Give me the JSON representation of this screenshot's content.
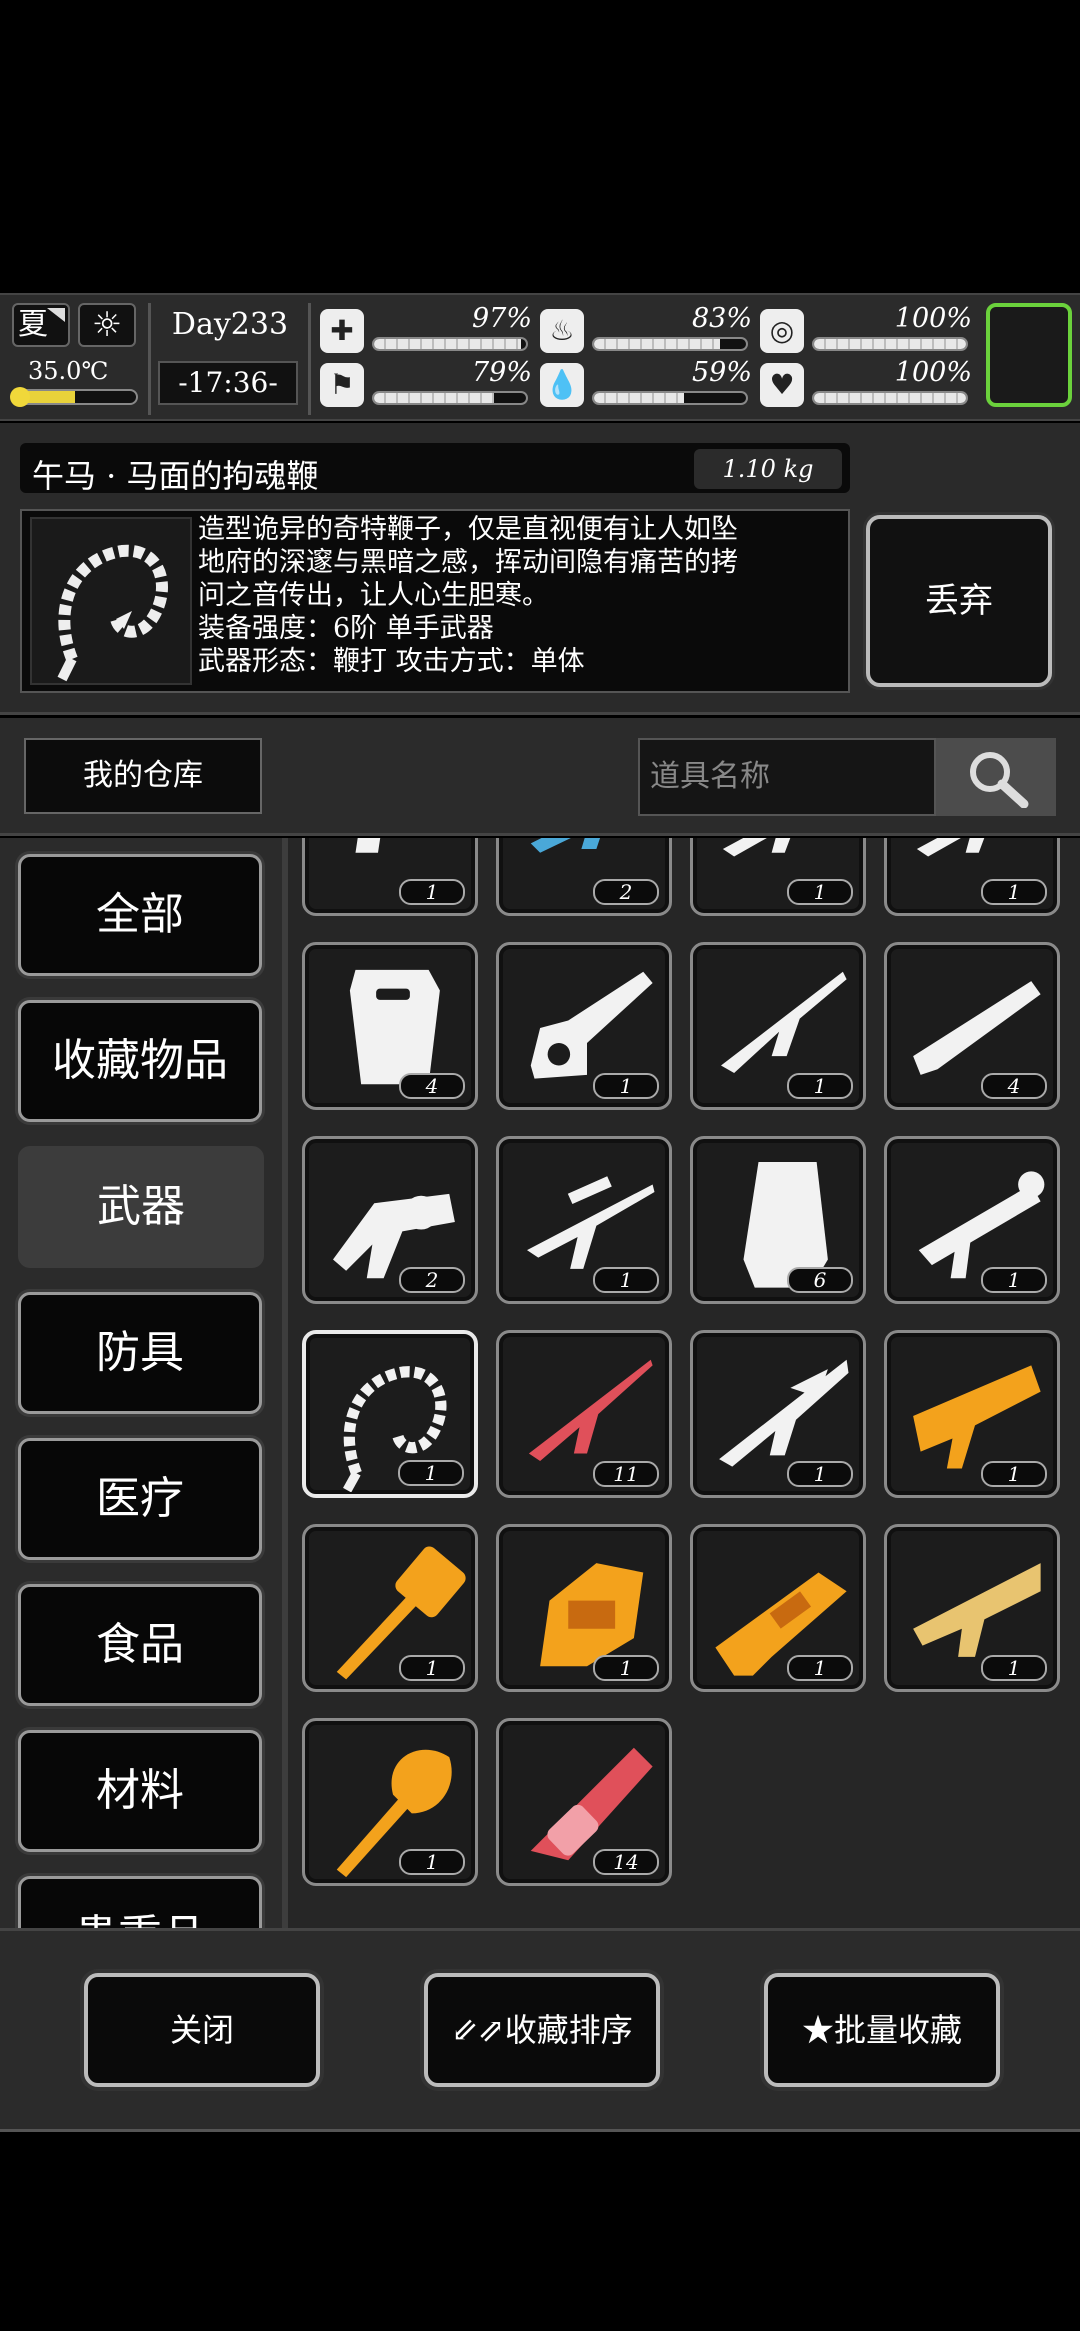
{
  "status": {
    "season": "夏",
    "weather_icon": "sun-icon",
    "temperature": "35.0℃",
    "temperature_level": 0.5,
    "day": "Day233",
    "clock": "-17:36-",
    "stats": [
      {
        "icon": "medkit-icon",
        "glyph": "✚",
        "percent": "97%",
        "level": 0.97
      },
      {
        "icon": "stomach-icon",
        "glyph": "♨",
        "percent": "83%",
        "level": 0.83
      },
      {
        "icon": "brain-icon",
        "glyph": "◎",
        "percent": "100%",
        "level": 1.0
      },
      {
        "icon": "stamina-icon",
        "glyph": "⚑",
        "percent": "79%",
        "level": 0.79
      },
      {
        "icon": "water-icon",
        "glyph": "💧",
        "percent": "59%",
        "level": 0.59
      },
      {
        "icon": "heart-icon",
        "glyph": "♥",
        "percent": "100%",
        "level": 1.0
      }
    ]
  },
  "detail": {
    "name": "午马 · 马面的拘魂鞭",
    "weight": "1.10 kg",
    "description": [
      "造型诡异的奇特鞭子，仅是直视便有让人如坠",
      "地府的深邃与黑暗之感，挥动间隐有痛苦的拷",
      "问之音传出，让人心生胆寒。",
      "装备强度：6阶 单手武器",
      "武器形态：鞭打 攻击方式：单体"
    ],
    "discard_label": "丢弃"
  },
  "warehouse_label": "我的仓库",
  "search": {
    "placeholder": "道具名称"
  },
  "categories": [
    "全部",
    "收藏物品",
    "武器",
    "防具",
    "医疗",
    "食品",
    "材料",
    "贵重品"
  ],
  "active_category": "武器",
  "items": [
    {
      "name": "pistol",
      "count": "1"
    },
    {
      "name": "blue-rifle",
      "count": "2"
    },
    {
      "name": "assault-rifle",
      "count": "1"
    },
    {
      "name": "carbine",
      "count": "1"
    },
    {
      "name": "riot-shield",
      "count": "4"
    },
    {
      "name": "chainsaw",
      "count": "1"
    },
    {
      "name": "battle-rifle",
      "count": "1"
    },
    {
      "name": "shotgun",
      "count": "4"
    },
    {
      "name": "grenade-launcher",
      "count": "2"
    },
    {
      "name": "sniper-rifle",
      "count": "1"
    },
    {
      "name": "heavy-shield",
      "count": "6"
    },
    {
      "name": "rocket-launcher",
      "count": "1"
    },
    {
      "name": "bone-whip",
      "count": "1"
    },
    {
      "name": "red-sniper-rifle",
      "count": "11"
    },
    {
      "name": "dragon-rifle",
      "count": "1"
    },
    {
      "name": "golden-cannon",
      "count": "1"
    },
    {
      "name": "golden-hammer",
      "count": "1"
    },
    {
      "name": "golden-chainsaw",
      "count": "1"
    },
    {
      "name": "golden-blaster",
      "count": "1"
    },
    {
      "name": "golden-shotgun",
      "count": "1"
    },
    {
      "name": "horse-head-mace",
      "count": "1"
    },
    {
      "name": "red-minigun",
      "count": "14"
    }
  ],
  "bottom": {
    "close": "关闭",
    "sort_icon": "swap-arrows-icon",
    "sort": "收藏排序",
    "batch_icon": "star-icon",
    "batch": "批量收藏"
  },
  "colors": {
    "panel": "#2b2b2b",
    "dark": "#0a0a0a",
    "accent_green": "#6bd13c",
    "gold": "#f3a21c",
    "red": "#e0505a",
    "blue": "#4aa8d8"
  }
}
